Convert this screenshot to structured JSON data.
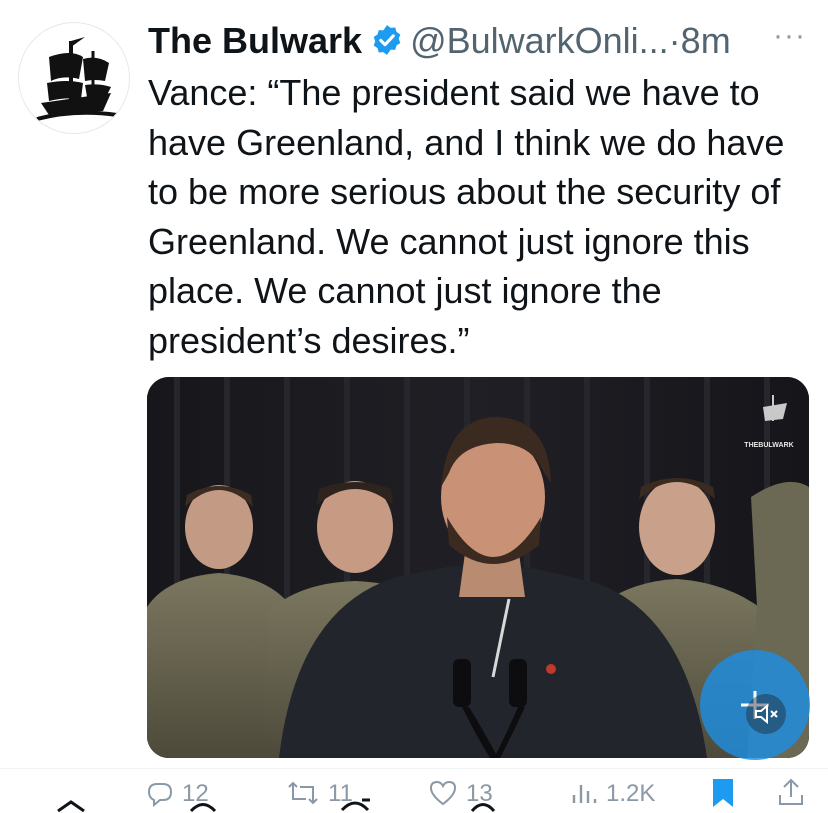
{
  "tweet": {
    "author_name": "The Bulwark",
    "verified": true,
    "handle": "@BulwarkOnli...",
    "separator": "·",
    "time": "8m",
    "more_label": "···",
    "text": "Vance: “The president said we have to have Greenland, and I think we do have to be more serious about the security of Greenland. We cannot just ignore this place. We cannot just ignore the president’s desires.”"
  },
  "media": {
    "watermark": "THEBULWARK",
    "muted": true
  },
  "actions": {
    "replies": "12",
    "retweets": "11",
    "likes": "13",
    "views": "1.2K"
  },
  "colors": {
    "accent": "#1d9bf0",
    "text": "#0f1419",
    "muted_text": "#536471",
    "fab": "#1d8ee0"
  },
  "icons": [
    "ship-logo-icon",
    "verified-badge-icon",
    "more-icon",
    "reply-icon",
    "retweet-icon",
    "like-icon",
    "views-icon",
    "bookmark-icon",
    "share-icon",
    "compose-plus-icon",
    "volume-mute-icon"
  ]
}
